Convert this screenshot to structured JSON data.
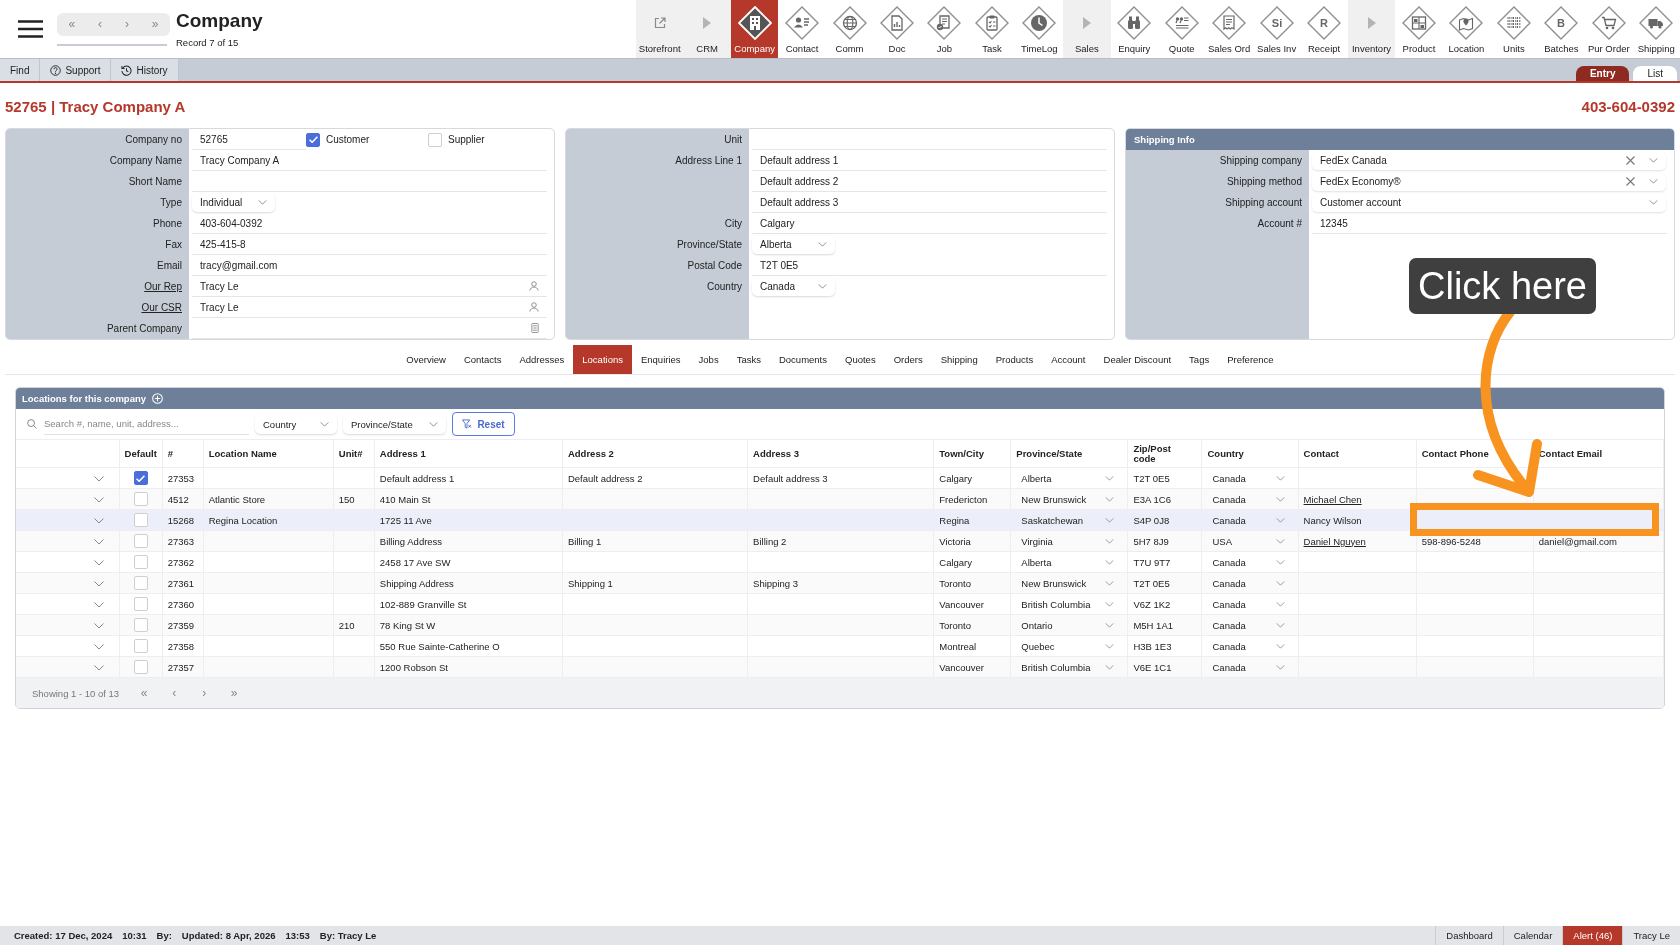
{
  "header": {
    "nav": [
      "«",
      "‹",
      "›",
      "»"
    ],
    "title": "Company",
    "subtitle": "Record 7 of 15"
  },
  "modules": [
    {
      "label": "Storefront",
      "kind": "link",
      "selected": false
    },
    {
      "label": "CRM",
      "kind": "group",
      "selected": false
    },
    {
      "label": "Company",
      "kind": "module",
      "selected": true
    },
    {
      "label": "Contact",
      "kind": "module",
      "selected": false
    },
    {
      "label": "Comm",
      "kind": "module",
      "selected": false
    },
    {
      "label": "Doc",
      "kind": "module",
      "selected": false
    },
    {
      "label": "Job",
      "kind": "module",
      "selected": false
    },
    {
      "label": "Task",
      "kind": "module",
      "selected": false
    },
    {
      "label": "TimeLog",
      "kind": "module",
      "selected": false
    },
    {
      "label": "Sales",
      "kind": "group",
      "selected": false
    },
    {
      "label": "Enquiry",
      "kind": "module",
      "selected": false
    },
    {
      "label": "Quote",
      "kind": "module",
      "selected": false
    },
    {
      "label": "Sales Ord",
      "kind": "module",
      "selected": false
    },
    {
      "label": "Sales Inv",
      "kind": "module",
      "glyph": "Si",
      "selected": false
    },
    {
      "label": "Receipt",
      "kind": "module",
      "glyph": "R",
      "selected": false
    },
    {
      "label": "Inventory",
      "kind": "group",
      "selected": false
    },
    {
      "label": "Product",
      "kind": "module",
      "selected": false
    },
    {
      "label": "Location",
      "kind": "module",
      "selected": false
    },
    {
      "label": "Units",
      "kind": "module",
      "selected": false
    },
    {
      "label": "Batches",
      "kind": "module",
      "glyph": "B",
      "selected": false
    },
    {
      "label": "Pur Order",
      "kind": "module",
      "selected": false
    },
    {
      "label": "Shipping",
      "kind": "module",
      "selected": false
    }
  ],
  "toolbar": {
    "buttons": [
      {
        "label": "Find",
        "kind": "plain"
      },
      {
        "label": "Support",
        "kind": "help"
      },
      {
        "label": "History",
        "kind": "history"
      }
    ],
    "views": [
      {
        "label": "Entry",
        "selected": true
      },
      {
        "label": "List",
        "selected": false
      }
    ]
  },
  "record": {
    "title": "52765 | Tracy Company A",
    "phone": "403-604-0392"
  },
  "company_panel": {
    "rows": [
      {
        "label": "Company no",
        "kind": "checks",
        "value": "52765",
        "checks": [
          {
            "label": "Customer",
            "checked": true
          },
          {
            "label": "Supplier",
            "checked": false
          }
        ]
      },
      {
        "label": "Company Name",
        "kind": "text",
        "value": "Tracy Company A"
      },
      {
        "label": "Short Name",
        "kind": "text"
      },
      {
        "label": "Type",
        "kind": "dropdown",
        "value": "Individual"
      },
      {
        "label": "Phone",
        "kind": "text",
        "value": "403-604-0392"
      },
      {
        "label": "Fax",
        "kind": "text",
        "value": "425-415-8"
      },
      {
        "label": "Email",
        "kind": "text",
        "value": "tracy@gmail.com"
      },
      {
        "label": "Our Rep",
        "kind": "person",
        "value": "Tracy Le"
      },
      {
        "label": "Our CSR",
        "kind": "person",
        "value": "Tracy Le"
      },
      {
        "label": "Parent Company",
        "kind": "picker"
      }
    ]
  },
  "address_panel": {
    "rows": [
      {
        "label": "Unit",
        "kind": "text"
      },
      {
        "label": "Address Line 1",
        "kind": "text",
        "value": "Default address 1"
      },
      {
        "kind": "text",
        "value": "Default address 2"
      },
      {
        "kind": "text",
        "value": "Default address 3"
      },
      {
        "label": "City",
        "kind": "text",
        "value": "Calgary"
      },
      {
        "label": "Province/State",
        "kind": "dropdown",
        "value": "Alberta"
      },
      {
        "label": "Postal Code",
        "kind": "text",
        "value": "T2T 0E5"
      },
      {
        "label": "Country",
        "kind": "dropdown",
        "value": "Canada"
      }
    ]
  },
  "shipping_panel": {
    "title": "Shipping Info",
    "rows": [
      {
        "label": "Shipping company",
        "kind": "select",
        "value": "FedEx Canada",
        "clearable": true
      },
      {
        "label": "Shipping method",
        "kind": "select",
        "value": "FedEx Economy®",
        "clearable": true
      },
      {
        "label": "Shipping account",
        "kind": "select",
        "value": "Customer account",
        "clearable": false
      },
      {
        "label": "Account #",
        "kind": "text",
        "value": "12345"
      }
    ]
  },
  "tabs": [
    {
      "label": "Overview",
      "selected": false
    },
    {
      "label": "Contacts",
      "selected": false
    },
    {
      "label": "Addresses",
      "selected": false
    },
    {
      "label": "Locations",
      "selected": true
    },
    {
      "label": "Enquiries",
      "selected": false
    },
    {
      "label": "Jobs",
      "selected": false
    },
    {
      "label": "Tasks",
      "selected": false
    },
    {
      "label": "Documents",
      "selected": false
    },
    {
      "label": "Quotes",
      "selected": false
    },
    {
      "label": "Orders",
      "selected": false
    },
    {
      "label": "Shipping",
      "selected": false
    },
    {
      "label": "Products",
      "selected": false
    },
    {
      "label": "Account",
      "selected": false
    },
    {
      "label": "Dealer Discount",
      "selected": false
    },
    {
      "label": "Tags",
      "selected": false
    },
    {
      "label": "Preference",
      "selected": false
    }
  ],
  "locations": {
    "title": "Locations for this company",
    "search": {
      "placeholder": "Search #, name, unit, address..."
    },
    "filters": [
      "Country",
      "Province/State"
    ],
    "reset": "Reset",
    "columns": [
      "Default",
      "#",
      "Location Name",
      "Unit#",
      "Address 1",
      "Address 2",
      "Address 3",
      "Town/City",
      "Province/State",
      "Zip/Post code",
      "Country",
      "Contact",
      "Contact Phone",
      "Contact Email"
    ],
    "rows": [
      {
        "id": "27353",
        "default": true,
        "address_1": "Default address 1",
        "address_2": "Default address 2",
        "address_3": "Default address 3",
        "city": "Calgary",
        "province": "Alberta",
        "zip": "T2T 0E5",
        "country": "Canada",
        "selected": false
      },
      {
        "id": "4512",
        "default": false,
        "location_name": "Atlantic Store",
        "unit": "150",
        "address_1": "410 Main St",
        "city": "Fredericton",
        "province": "New Brunswick",
        "zip": "E3A 1C6",
        "country": "Canada",
        "contact": "Michael Chen",
        "contact_link": true,
        "selected": false
      },
      {
        "id": "15268",
        "default": false,
        "location_name": "Regina Location",
        "address_1": "1725 11 Ave",
        "city": "Regina",
        "province": "Saskatchewan",
        "zip": "S4P 0J8",
        "country": "Canada",
        "contact": "Nancy Wilson",
        "contact_link": false,
        "selected": true
      },
      {
        "id": "27363",
        "default": false,
        "address_1": "Billing Address",
        "address_2": "Billing 1",
        "address_3": "Billing 2",
        "city": "Victoria",
        "province": "Virginia",
        "zip": "5H7 8J9",
        "country": "USA",
        "contact": "Daniel Nguyen",
        "contact_link": true,
        "phone": "598-896-5248",
        "email": "daniel@gmail.com",
        "selected": false
      },
      {
        "id": "27362",
        "default": false,
        "address_1": "2458 17 Ave SW",
        "city": "Calgary",
        "province": "Alberta",
        "zip": "T7U 9T7",
        "country": "Canada",
        "selected": false
      },
      {
        "id": "27361",
        "default": false,
        "address_1": "Shipping Address",
        "address_2": "Shipping 1",
        "address_3": "Shipping 3",
        "city": "Toronto",
        "province": "New Brunswick",
        "zip": "T2T 0E5",
        "country": "Canada",
        "selected": false
      },
      {
        "id": "27360",
        "default": false,
        "address_1": "102-889 Granville St",
        "city": "Vancouver",
        "province": "British Columbia",
        "zip": "V6Z 1K2",
        "country": "Canada",
        "selected": false
      },
      {
        "id": "27359",
        "default": false,
        "unit": "210",
        "address_1": "78 King St W",
        "city": "Toronto",
        "province": "Ontario",
        "zip": "M5H 1A1",
        "country": "Canada",
        "selected": false
      },
      {
        "id": "27358",
        "default": false,
        "address_1": "550 Rue Sainte-Catherine O",
        "city": "Montreal",
        "province": "Quebec",
        "zip": "H3B 1E3",
        "country": "Canada",
        "selected": false
      },
      {
        "id": "27357",
        "default": false,
        "address_1": "1200 Robson St",
        "city": "Vancouver",
        "province": "British Columbia",
        "zip": "V6E 1C1",
        "country": "Canada",
        "selected": false
      }
    ],
    "footer": "Showing 1 - 10 of 13",
    "pager": [
      "«",
      "‹",
      "›",
      "»"
    ]
  },
  "status_bar": {
    "left": [
      "Created: 17 Dec, 2024",
      "10:31",
      "By:",
      "Updated: 8 Apr, 2026",
      "13:53",
      "By: Tracy Le"
    ],
    "right": [
      {
        "label": "Dashboard",
        "kind": "link"
      },
      {
        "label": "Calendar",
        "kind": "link"
      },
      {
        "label": "Alert (46)",
        "kind": "alert"
      },
      {
        "label": "Tracy Le",
        "kind": "link"
      }
    ]
  },
  "annotation": {
    "callout": "Click here"
  }
}
